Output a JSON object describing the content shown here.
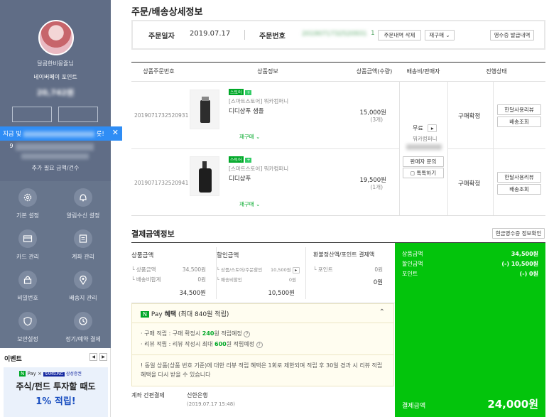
{
  "sidebar": {
    "user_greeting": "달콤한비몽쥴님",
    "membership": "네이버페이 포인트",
    "points_blurred": "20,742원",
    "banner_text": "지금 빛",
    "banner_suffix": "릇!",
    "count_text": "9",
    "sub_caption": "추가 필요 금액/건수",
    "menu": [
      {
        "label": "기본 설정",
        "icon": "gear-icon"
      },
      {
        "label": "알림수신 설정",
        "icon": "bell-icon"
      },
      {
        "label": "카드 관리",
        "icon": "card-icon"
      },
      {
        "label": "계좌 관리",
        "icon": "account-icon"
      },
      {
        "label": "비밀번호",
        "icon": "lock-icon"
      },
      {
        "label": "배송지 관리",
        "icon": "location-icon"
      },
      {
        "label": "보안설정",
        "icon": "shield-icon"
      },
      {
        "label": "정기/예약 결제",
        "icon": "clock-icon"
      }
    ],
    "event": {
      "title": "이벤트",
      "prev": "◀",
      "next": "▶",
      "brand_pay": "Pay",
      "brand_samsung": "SAMSUNG",
      "brand_securities": "삼성증권",
      "headline": "주식/펀드 투자할 때도",
      "highlight": "1% 적립!"
    }
  },
  "page": {
    "title": "주문/배송상세정보",
    "order_date_label": "주문일자",
    "order_date": "2019.07.17",
    "order_no_label": "주문번호",
    "order_no_blurred": "2019071732520931",
    "order_no_tail": "1",
    "btn_delete": "주문내역 삭제",
    "btn_reorder": "재구매",
    "btn_receipt": "영수증 발급내역"
  },
  "table": {
    "headers": [
      "상품주문번호",
      "상품정보",
      "상품금액(수량)",
      "배송비/판매자",
      "진행상태"
    ],
    "rows": [
      {
        "order_no": "2019071732520931",
        "badge": "스토어",
        "store": "[스마트스토어] 뭐카컴퍼니",
        "name": "디디샴푸 샘플",
        "reorder": "재구매",
        "price": "15,000원",
        "qty": "(3개)",
        "status": "구매확정",
        "btn_review": "한달사용리뷰",
        "btn_track": "배송조회"
      },
      {
        "order_no": "2019071732520941",
        "badge": "스토어",
        "store": "[스마트스토어] 뭐카컴퍼니",
        "name": "디디샴푸",
        "reorder": "재구매",
        "price": "19,500원",
        "qty": "(1개)",
        "status": "구매확정",
        "btn_review": "한달사용리뷰",
        "btn_track": "배송조회"
      }
    ],
    "shipping": {
      "fee": "무료",
      "seller": "뭐카컴퍼니",
      "btn_ask": "판매자 문의",
      "btn_talk": "톡톡하기"
    }
  },
  "payment": {
    "title": "결제금액정보",
    "btn_cash_receipt": "현금영수증 정보확인",
    "col_product": {
      "label": "상품금액",
      "lines": [
        [
          "상품금액",
          "34,500원"
        ],
        [
          "배송비합계",
          "0원"
        ]
      ],
      "total": "34,500원"
    },
    "col_discount": {
      "label": "할인금액",
      "lines": [
        [
          "상품/스토어/주문할인",
          "10,500원"
        ],
        [
          "배송비할인",
          "0원"
        ]
      ],
      "total": "10,500원"
    },
    "col_refund": {
      "label": "환불정산액/포인트 결제액",
      "lines": [
        [
          "포인트",
          "0원"
        ]
      ],
      "total": "0원"
    },
    "summary": {
      "rows": [
        [
          "상품금액",
          "34,500원"
        ],
        [
          "할인금액",
          "(-) 10,500원"
        ],
        [
          "포인트",
          "(-) 0원"
        ]
      ],
      "final_label": "결제금액",
      "final_value": "24,000원"
    },
    "npay": {
      "brand": "Pay",
      "title_pre": "혜택",
      "title_detail": "(최대 840원 적립)",
      "line1_pre": "· 구매 적립 : 구매 확정시",
      "line1_amount": "240",
      "line1_post": "원 적립예정",
      "line2_pre": "· 리뷰 적립 : 리뷰 작성시 최대",
      "line2_amount": "600",
      "line2_post": "원 적립예정",
      "notice": "! 동일 상품(상품 번호 기준)에 대한 리뷰 적립 혜택은 1회로 제한되며 적립 후 30일 경과 시 리뷰 적립 혜택을 다시 받을 수 있습니다"
    },
    "method_label": "계좌 간편결제",
    "bank": "신한은행",
    "paid_at": "(2019.07.17 15:48)"
  },
  "colors": {
    "sidebar": "#67758c",
    "accent_green": "#03c40c",
    "banner_blue": "#2f8df5"
  }
}
